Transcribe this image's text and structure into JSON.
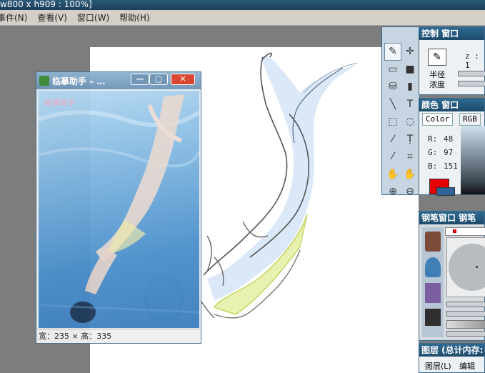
{
  "window": {
    "title": "w800 x h909 : 100%]"
  },
  "menu": [
    {
      "label": "事件(N)"
    },
    {
      "label": "查看(V)"
    },
    {
      "label": "窗口(W)"
    },
    {
      "label": "帮助(H)"
    }
  ],
  "reference": {
    "title": "临摹助手 – …",
    "status": "宽：235 × 高：335",
    "watermark": "临摹助手"
  },
  "panels": {
    "control": {
      "title": "控制 窗口",
      "z_label": "z : 1",
      "radius_label": "半径",
      "density_label": "浓度"
    },
    "color": {
      "title": "颜色 窗口",
      "tabs": [
        "Color",
        "RGB"
      ],
      "r_label": "R:",
      "r": "48",
      "g_label": "G:",
      "g": "97",
      "b_label": "B:",
      "b": "151",
      "primary": "#e40000",
      "secondary": "#306197"
    },
    "brush": {
      "title": "钢笔窗口 钢笔"
    },
    "layers": {
      "title": "图层 (总计内存:",
      "menu_layer": "图层(L)",
      "menu_edit": "编辑(E)"
    }
  },
  "tools": [
    {
      "icon": "pen-icon",
      "glyph": "✎",
      "selected": true
    },
    {
      "icon": "move-icon",
      "glyph": "✛"
    },
    {
      "icon": "rect-select-icon",
      "glyph": "▭"
    },
    {
      "icon": "fill-rect-icon",
      "glyph": "■"
    },
    {
      "icon": "bucket-icon",
      "glyph": "⛁"
    },
    {
      "icon": "gradient-icon",
      "glyph": "▮"
    },
    {
      "icon": "line-icon",
      "glyph": "╲"
    },
    {
      "icon": "text-icon",
      "glyph": "T"
    },
    {
      "icon": "marquee-icon",
      "glyph": "⬚"
    },
    {
      "icon": "lasso-icon",
      "glyph": "◌"
    },
    {
      "icon": "wand-icon",
      "glyph": "⁄"
    },
    {
      "icon": "text-select-icon",
      "glyph": "Ṭ"
    },
    {
      "icon": "eyedropper-icon",
      "glyph": "⁄"
    },
    {
      "icon": "crop-icon",
      "glyph": "⌗"
    },
    {
      "icon": "hand-icon",
      "glyph": "✋"
    },
    {
      "icon": "rotate-hand-icon",
      "glyph": "✋"
    },
    {
      "icon": "zoom-in-icon",
      "glyph": "⊕"
    },
    {
      "icon": "zoom-out-icon",
      "glyph": "⊖"
    }
  ]
}
